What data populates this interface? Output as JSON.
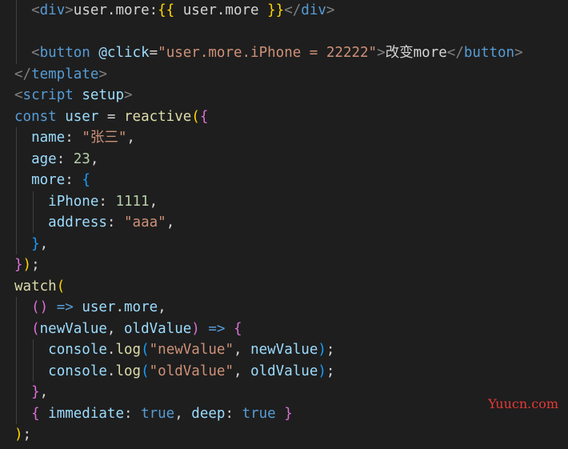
{
  "editor": {
    "background": "#1e1e1e",
    "lines": [
      "  <div>user.more:{{ user.more }}</div>",
      "",
      "  <button @click=\"user.more.iPhone = 22222\">改变more</button>",
      "</template>",
      "<script setup>",
      "const user = reactive({",
      "  name: \"张三\",",
      "  age: 23,",
      "  more: {",
      "    iPhone: 1111,",
      "    address: \"aaa\",",
      "  },",
      "});",
      "watch(",
      "  () => user.more,",
      "  (newValue, oldValue) => {",
      "    console.log(\"newValue\", newValue);",
      "    console.log(\"oldValue\", oldValue);",
      "  },",
      "  { immediate: true, deep: true }",
      ");"
    ]
  },
  "code": {
    "l1": {
      "open_lt": "<",
      "open_tag": "div",
      "open_gt": ">",
      "text": "user.more:",
      "mustache_open": "{{",
      "expr": " user.more ",
      "mustache_close": "}}",
      "close_lt": "</",
      "close_tag": "div",
      "close_gt": ">"
    },
    "l3": {
      "lt": "<",
      "tag": "button",
      "sp": " ",
      "attr": "@click",
      "eq": "=",
      "value": "\"user.more.iPhone = 22222\"",
      "gt": ">",
      "text": "改变more",
      "close_lt": "</",
      "close_tag": "button",
      "close_gt": ">"
    },
    "l4": {
      "lt": "</",
      "tag": "template",
      "gt": ">"
    },
    "l5": {
      "lt": "<",
      "tag": "script",
      "sp": " ",
      "attr": "setup",
      "gt": ">"
    },
    "l6": {
      "kw": "const",
      "sp1": " ",
      "var": "user",
      "eq": " = ",
      "fn": "reactive",
      "p": "(",
      "b": "{"
    },
    "l7": {
      "key": "name",
      "colon": ": ",
      "value": "\"张三\"",
      "comma": ","
    },
    "l8": {
      "key": "age",
      "colon": ": ",
      "value": "23",
      "comma": ","
    },
    "l9": {
      "key": "more",
      "colon": ": ",
      "b": "{"
    },
    "l10": {
      "key": "iPhone",
      "colon": ": ",
      "value": "1111",
      "comma": ","
    },
    "l11": {
      "key": "address",
      "colon": ": ",
      "value": "\"aaa\"",
      "comma": ","
    },
    "l12": {
      "b": "}",
      "comma": ","
    },
    "l13": {
      "b": "}",
      "p": ")",
      "semi": ";"
    },
    "l14": {
      "fn": "watch",
      "p": "("
    },
    "l15": {
      "p": "()",
      "arrow": " => ",
      "obj": "user",
      "dot": ".",
      "prop": "more",
      "comma": ","
    },
    "l16": {
      "p_open": "(",
      "a1": "newValue",
      "comma": ", ",
      "a2": "oldValue",
      "p_close": ")",
      "arrow": " => ",
      "b": "{"
    },
    "l17": {
      "obj": "console",
      "dot": ".",
      "fn": "log",
      "p_open": "(",
      "str": "\"newValue\"",
      "comma": ", ",
      "arg": "newValue",
      "p_close": ")",
      "semi": ";"
    },
    "l18": {
      "obj": "console",
      "dot": ".",
      "fn": "log",
      "p_open": "(",
      "str": "\"oldValue\"",
      "comma": ", ",
      "arg": "oldValue",
      "p_close": ")",
      "semi": ";"
    },
    "l19": {
      "b": "}",
      "comma": ","
    },
    "l20": {
      "b_open": "{",
      "k1": " immediate",
      "c1": ": ",
      "v1": "true",
      "comma": ", ",
      "k2": "deep",
      "c2": ": ",
      "v2": "true",
      "b_close": " }"
    },
    "l21": {
      "p": ")",
      "semi": ";"
    }
  },
  "watermark": {
    "text": "Yuucn.com",
    "color": "#e53935"
  }
}
